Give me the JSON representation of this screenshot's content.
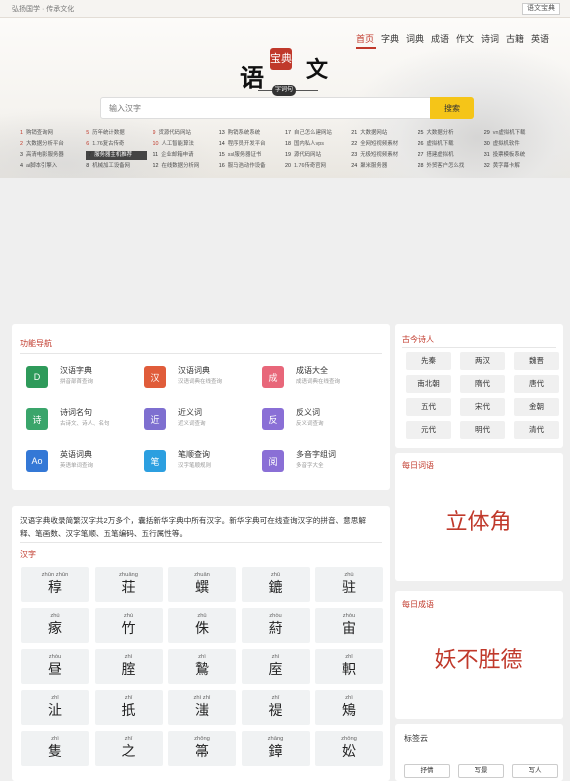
{
  "topbar": {
    "slogan": "弘扬国学 · 传承文化",
    "version_button": "语文宝典"
  },
  "nav": [
    "首页",
    "字典",
    "词典",
    "成语",
    "作文",
    "诗词",
    "古籍",
    "英语"
  ],
  "logo": {
    "main": "语",
    "seal": "宝典",
    "wen": "文",
    "sub": "字词句"
  },
  "search": {
    "placeholder": "输入汉字",
    "button": "搜索"
  },
  "hot_links": [
    {
      "n": "1",
      "t": "购销查询网"
    },
    {
      "n": "5",
      "t": "历年统计数据"
    },
    {
      "n": "9",
      "t": "货源代码网站"
    },
    {
      "n": "13",
      "t": "购销系统系统"
    },
    {
      "n": "17",
      "t": "自己怎么建网站"
    },
    {
      "n": "21",
      "t": "大数据网站"
    },
    {
      "n": "25",
      "t": "大数据分析"
    },
    {
      "n": "29",
      "t": "vn虚拟机下载"
    },
    {
      "n": "2",
      "t": "大数据分析平台"
    },
    {
      "n": "6",
      "t": "1.76复古传奇"
    },
    {
      "n": "10",
      "t": "人工智能算法"
    },
    {
      "n": "14",
      "t": "程序员开发平台"
    },
    {
      "n": "18",
      "t": "国内私人vps"
    },
    {
      "n": "22",
      "t": "全网短视频素材"
    },
    {
      "n": "26",
      "t": "虚拟机下载"
    },
    {
      "n": "30",
      "t": "虚拟机软件"
    },
    {
      "n": "3",
      "t": "高清电影服务器"
    },
    {
      "n": "7",
      "t": "服务器主机推荐",
      "sel": true
    },
    {
      "n": "11",
      "t": "企业邮箱申请"
    },
    {
      "n": "15",
      "t": "ssl服务器证书"
    },
    {
      "n": "19",
      "t": "源代码网站"
    },
    {
      "n": "23",
      "t": "无极短视频素材"
    },
    {
      "n": "27",
      "t": "搭建虚拟机"
    },
    {
      "n": "31",
      "t": "投票模板系统"
    },
    {
      "n": "4",
      "t": "ai脚本引擎入"
    },
    {
      "n": "8",
      "t": "机械加工设备网"
    },
    {
      "n": "12",
      "t": "在线数据分析网"
    },
    {
      "n": "16",
      "t": "服马浩动作设备"
    },
    {
      "n": "20",
      "t": "1.76传奇官网"
    },
    {
      "n": "24",
      "t": "聚米服务器"
    },
    {
      "n": "28",
      "t": "外贸客户怎么找"
    },
    {
      "n": "32",
      "t": "黄字幕卡解"
    }
  ],
  "features": {
    "title": "功能导航",
    "items": [
      {
        "name": "汉语字典",
        "desc": "拼音部首查询",
        "color": "#2e9a5a",
        "icon": "D"
      },
      {
        "name": "汉语词典",
        "desc": "汉语词典在线查询",
        "color": "#e05c3a",
        "icon": "汉"
      },
      {
        "name": "成语大全",
        "desc": "成语词典在线查询",
        "color": "#e8677a",
        "icon": "成"
      },
      {
        "name": "诗词名句",
        "desc": "古诗文、诗人、名句",
        "color": "#3aa56b",
        "icon": "诗"
      },
      {
        "name": "近义词",
        "desc": "近义词查询",
        "color": "#7e6fd0",
        "icon": "近"
      },
      {
        "name": "反义词",
        "desc": "反义词查询",
        "color": "#8a6fd6",
        "icon": "反"
      },
      {
        "name": "英语词典",
        "desc": "英语单词查询",
        "color": "#3478d6",
        "icon": "Ao"
      },
      {
        "name": "笔顺查询",
        "desc": "汉字笔顺规则",
        "color": "#2c9fe0",
        "icon": "笔"
      },
      {
        "name": "多音字组词",
        "desc": "多音字大全",
        "color": "#8a6fd6",
        "icon": "阅"
      }
    ]
  },
  "dict": {
    "description": "汉语字典收录简繁汉字共2万多个，囊括新华字典中所有汉字。新华字典可在线查询汉字的拼音、意思解释、笔画数、汉字笔顺、五笔编码、五行属性等。",
    "section_title": "汉字",
    "chars": [
      {
        "py": "zhūn zhūn",
        "ch": "稕"
      },
      {
        "py": "zhuāng",
        "ch": "荘"
      },
      {
        "py": "zhuān",
        "ch": "蟤"
      },
      {
        "py": "zhū",
        "ch": "鏕"
      },
      {
        "py": "zhù",
        "ch": "驻"
      },
      {
        "py": "zhú",
        "ch": "瘃"
      },
      {
        "py": "zhú",
        "ch": "竹"
      },
      {
        "py": "zhū",
        "ch": "侏"
      },
      {
        "py": "zhòu",
        "ch": "葤"
      },
      {
        "py": "zhòu",
        "ch": "宙"
      },
      {
        "py": "zhòu",
        "ch": "昼"
      },
      {
        "py": "zhì",
        "ch": "腟"
      },
      {
        "py": "zhì",
        "ch": "鷙"
      },
      {
        "py": "zhì",
        "ch": "庢"
      },
      {
        "py": "zhǐ",
        "ch": "軹"
      },
      {
        "py": "zhǐ",
        "ch": "沚"
      },
      {
        "py": "zhǐ",
        "ch": "扺"
      },
      {
        "py": "zhì zhì",
        "ch": "滍"
      },
      {
        "py": "zhī",
        "ch": "禔"
      },
      {
        "py": "zhì",
        "ch": "鴙"
      },
      {
        "py": "zhì",
        "ch": "隻"
      },
      {
        "py": "zhī",
        "ch": "之"
      },
      {
        "py": "zhǒng",
        "ch": "箒"
      },
      {
        "py": "zhāng",
        "ch": "鏱"
      },
      {
        "py": "zhōng",
        "ch": "妐"
      }
    ]
  },
  "poets": {
    "title": "古今诗人",
    "items": [
      "先秦",
      "两汉",
      "魏晋",
      "南北朝",
      "隋代",
      "唐代",
      "五代",
      "宋代",
      "金朝",
      "元代",
      "明代",
      "清代"
    ]
  },
  "daily_word": {
    "title": "每日词语",
    "word": "立体角"
  },
  "daily_idiom": {
    "title": "每日成语",
    "word": "妖不胜德"
  },
  "tags": {
    "title": "标签云",
    "items": [
      "抒情",
      "写景",
      "写人"
    ]
  },
  "colors": {
    "accent": "#c0392b",
    "search_button": "#f5c518"
  }
}
